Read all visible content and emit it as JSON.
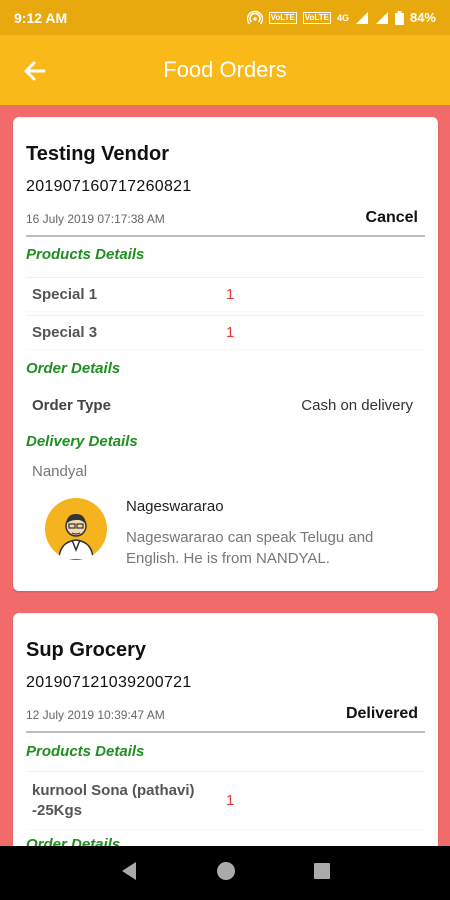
{
  "status_bar": {
    "time": "9:12 AM",
    "network_label_1": "VoLTE",
    "network_label_2": "VoLTE",
    "network_type": "4G",
    "battery": "84%"
  },
  "app_bar": {
    "title": "Food Orders",
    "back_icon": "arrow-left-icon"
  },
  "orders": [
    {
      "vendor": "Testing Vendor",
      "order_id": "201907160717260821",
      "date": "16 July 2019 07:17:38 AM",
      "status": "Cancel",
      "products_label": "Products Details",
      "products": [
        {
          "name": "Special 1",
          "qty": "1"
        },
        {
          "name": "Special 3",
          "qty": "1"
        }
      ],
      "order_details_label": "Order Details",
      "order_type_key": "Order Type",
      "order_type_value": "Cash on delivery",
      "delivery_label": "Delivery Details",
      "city": "Nandyal",
      "agent_name": "Nageswararao",
      "agent_desc": "Nageswararao can speak Telugu and English. He is from NANDYAL."
    },
    {
      "vendor": "Sup Grocery",
      "order_id": "201907121039200721",
      "date": "12 July 2019 10:39:47 AM",
      "status": "Delivered",
      "products_label": "Products Details",
      "products": [
        {
          "name": "kurnool Sona (pathavi) -25Kgs",
          "qty": "1"
        }
      ],
      "order_details_label": "Order Details"
    }
  ],
  "colors": {
    "background": "#f26b6b",
    "app_bar": "#f8b919",
    "status_bar": "#e8a90f",
    "section_label": "#1f8f1f",
    "quantity": "#e53935"
  }
}
